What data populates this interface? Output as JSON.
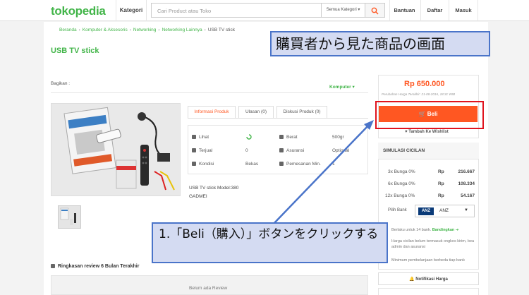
{
  "header": {
    "logo": "tokopedia",
    "kategori": "Kategori",
    "search_placeholder": "Cari Product atau Toko",
    "search_category": "Semua Kategori ▾",
    "nav": [
      "Bantuan",
      "Daftar",
      "Masuk"
    ]
  },
  "breadcrumb": [
    "Beranda",
    "Komputer & Aksesoris",
    "Networking",
    "Networking Lainnya",
    "USB TV stick"
  ],
  "product": {
    "title": "USB TV stick",
    "share_label": "Bagikan :",
    "category_link": "Komputer ▾",
    "tabs": [
      "Informasi Produk",
      "Ulasan (0)",
      "Diskusi Produk (0)"
    ],
    "info": {
      "lihat_label": "Lihat",
      "terjual_label": "Terjual",
      "terjual_value": "0",
      "kondisi_label": "Kondisi",
      "kondisi_value": "Bekas",
      "berat_label": "Berat",
      "berat_value": "500gr",
      "asuransi_label": "Asuransi",
      "asuransi_value": "Optional",
      "pemesanan_label": "Pemesanan Min.",
      "pemesanan_value": "1"
    },
    "description_line1": "USB TV stick Model:380",
    "description_line2": "GADMEI"
  },
  "review": {
    "heading": "Ringkasan review 6 Bulan Terakhir",
    "empty": "Belum ada Review"
  },
  "sidebar": {
    "price": "Rp 650.000",
    "price_note": "Perubahan Harga Terakhir: 21-08-2016, 18:31 WIB",
    "buy_label": "Beli",
    "wishlist_label": "Tambah Ke Wishlist",
    "cicilan": {
      "heading": "SIMULASI CICILAN",
      "rows": [
        {
          "label": "3x Bunga 0%",
          "currency": "Rp",
          "amount": "216.667"
        },
        {
          "label": "6x Bunga 0%",
          "currency": "Rp",
          "amount": "108.334"
        },
        {
          "label": "12x Bunga 0%",
          "currency": "Rp",
          "amount": "54.167"
        }
      ],
      "bank_label": "Pilih Bank",
      "bank_logo": "ANZ",
      "bank_value": "ANZ",
      "note1_prefix": "Berlaku untuk 14 bank.",
      "note1_link": "Bandingkan ➔",
      "note2": "Harga cicilan belum termasuk ongkos kirim, bea admin dan asuransi",
      "note3": "Minimum pembelanjaan berbeda tiap bank"
    },
    "notif_label": "Notifikasi Harga"
  },
  "annotations": {
    "top_label": "購買者から見た商品の画面",
    "callout": "1.「Beli（購入）」ボタンをクリックする"
  },
  "colors": {
    "brand": "#42b549",
    "accent": "#ff5722",
    "annotation_border": "#4a74c9",
    "highlight": "#e0141e"
  }
}
